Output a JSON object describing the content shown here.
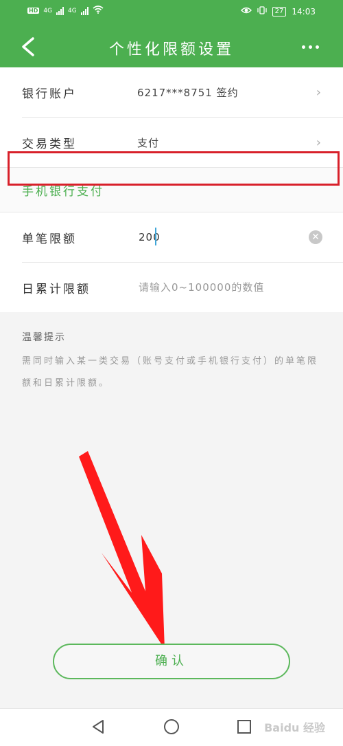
{
  "status_bar": {
    "network_left": [
      "4G",
      "4G"
    ],
    "hd_labels": [
      "HD",
      "HD"
    ],
    "battery": "27",
    "time": "14:03"
  },
  "header": {
    "title": "个性化限额设置"
  },
  "rows": {
    "bank_account": {
      "label": "银行账户",
      "value": "6217***8751 签约"
    },
    "transaction_type": {
      "label": "交易类型",
      "value": "支付"
    }
  },
  "section": {
    "mobile_banking": "手机银行支付"
  },
  "inputs": {
    "single_limit": {
      "label": "单笔限额",
      "value": "200",
      "placeholder": ""
    },
    "daily_limit": {
      "label": "日累计限额",
      "value": "",
      "placeholder": "请输入0~100000的数值"
    }
  },
  "tips": {
    "title": "温馨提示",
    "body": "需同时输入某一类交易（账号支付或手机银行支付）的单笔限额和日累计限额。"
  },
  "actions": {
    "confirm": "确认"
  },
  "watermark": "Baidu 经验",
  "colors": {
    "brand": "#4caf50",
    "highlight": "#d8202a",
    "annotation_arrow": "#ff1a1a"
  }
}
